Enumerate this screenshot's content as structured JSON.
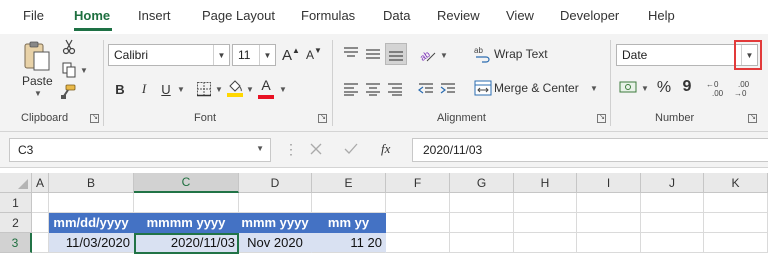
{
  "menu": {
    "tabs": [
      "File",
      "Home",
      "Insert",
      "Page Layout",
      "Formulas",
      "Data",
      "Review",
      "View",
      "Developer",
      "Help"
    ],
    "active_tab": "Home"
  },
  "clipboard": {
    "paste_label": "Paste",
    "group_label": "Clipboard"
  },
  "font": {
    "font_name": "Calibri",
    "font_size": "11",
    "bold": "B",
    "italic": "I",
    "underline": "U",
    "grow": "A",
    "shrink": "A",
    "font_color_letter": "A",
    "group_label": "Font"
  },
  "alignment": {
    "wrap_text": "Wrap Text",
    "merge_center": "Merge & Center",
    "group_label": "Alignment"
  },
  "number": {
    "format": "Date",
    "percent": "%",
    "comma": "9",
    "group_label": "Number"
  },
  "formula_bar": {
    "name_box": "C3",
    "fx": "fx",
    "formula": "2020/11/03"
  },
  "sheet": {
    "columns": [
      "A",
      "B",
      "C",
      "D",
      "E",
      "F",
      "G",
      "H",
      "I",
      "J",
      "K"
    ],
    "rows": [
      "1",
      "2",
      "3"
    ],
    "selected_column": "C",
    "selected_row": "3",
    "headers": [
      "mm/dd/yyyy",
      "mmmm yyyy",
      "mmm yyyy",
      "mm yy"
    ],
    "values": [
      "11/03/2020",
      "2020/11/03",
      "Nov 2020",
      "11 20"
    ]
  },
  "colors": {
    "accent": "#217346",
    "table_header": "#4472c4",
    "table_band": "#d9e1f2",
    "callout": "#e23a3a"
  }
}
